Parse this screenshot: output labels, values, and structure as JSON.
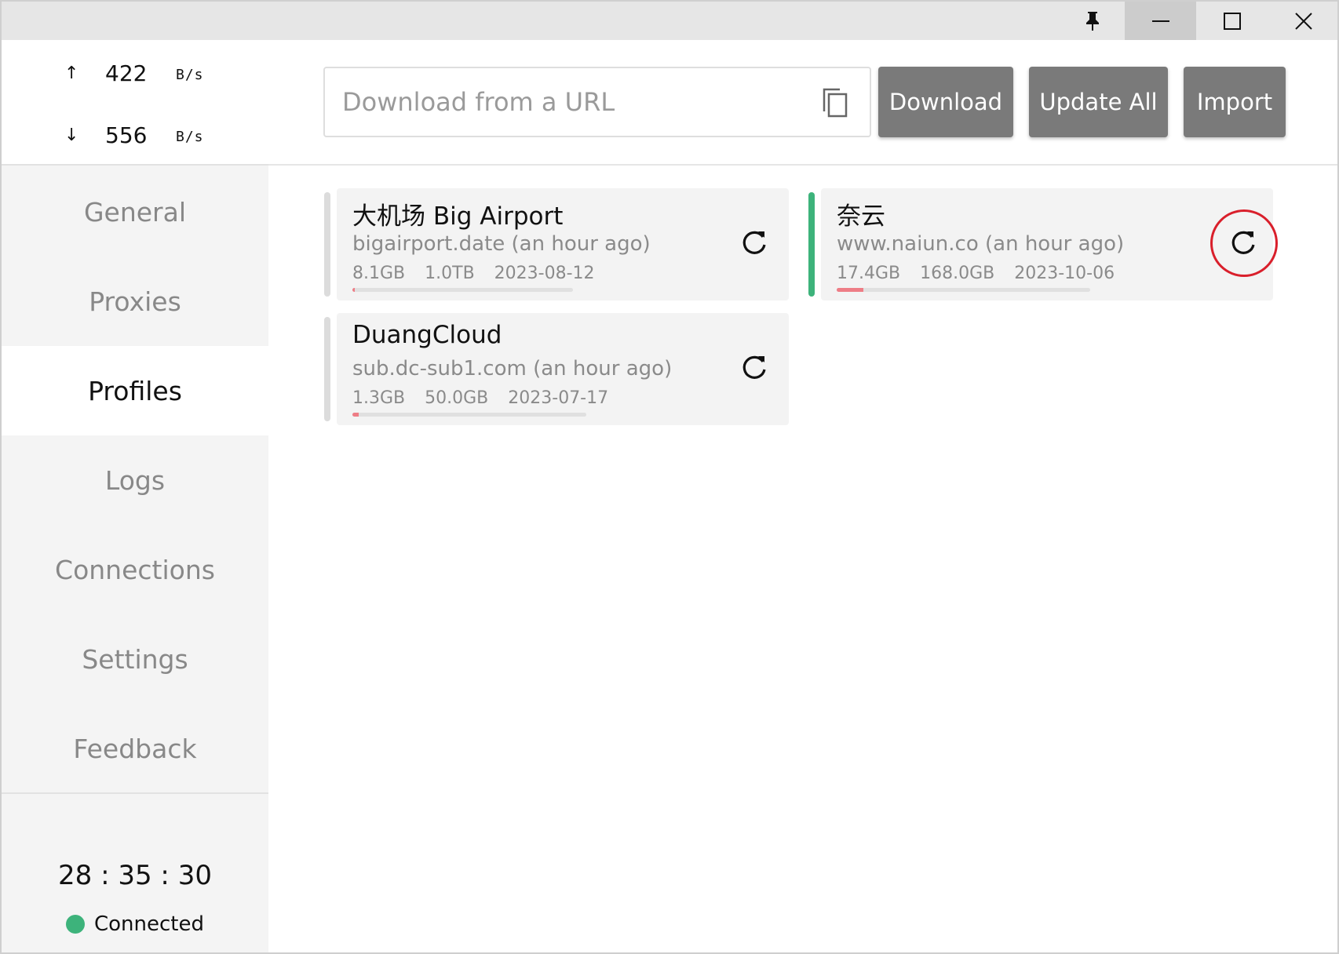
{
  "titlebar": {
    "icons": [
      "pin-icon",
      "minimize-icon",
      "maximize-icon",
      "close-icon"
    ]
  },
  "sidebar": {
    "traffic": {
      "upload": {
        "arrow": "↑",
        "value": "422",
        "unit": "B/s"
      },
      "download": {
        "arrow": "↓",
        "value": "556",
        "unit": "B/s"
      }
    },
    "nav": [
      {
        "label": "General"
      },
      {
        "label": "Proxies"
      },
      {
        "label": "Profiles",
        "active": true
      },
      {
        "label": "Logs"
      },
      {
        "label": "Connections"
      },
      {
        "label": "Settings"
      },
      {
        "label": "Feedback"
      }
    ],
    "uptime": "28 : 35 : 30",
    "status": {
      "label": "Connected",
      "color": "#3db37b"
    }
  },
  "toolbar": {
    "url_placeholder": "Download from a URL",
    "url_value": "",
    "download_label": "Download",
    "update_all_label": "Update All",
    "import_label": "Import"
  },
  "profiles": [
    {
      "name": "大机场 Big Airport",
      "source": "bigairport.date (an hour ago)",
      "used": "8.1GB",
      "total": "1.0TB",
      "expire": "2023-08-12",
      "usage_fraction": 0.008,
      "active": false
    },
    {
      "name": "奈云",
      "source": "www.naiun.co (an hour ago)",
      "used": "17.4GB",
      "total": "168.0GB",
      "expire": "2023-10-06",
      "usage_fraction": 0.104,
      "active": true,
      "highlighted": true
    },
    {
      "name": "DuangCloud",
      "source": "sub.dc-sub1.com (an hour ago)",
      "used": "1.3GB",
      "total": "50.0GB",
      "expire": "2023-07-17",
      "usage_fraction": 0.026,
      "active": false
    }
  ],
  "colors": {
    "accent_green": "#3db37b",
    "usage_bar": "#ee7d86",
    "highlight_circle": "#d91f2b",
    "button_bg": "#7a7a7a"
  }
}
